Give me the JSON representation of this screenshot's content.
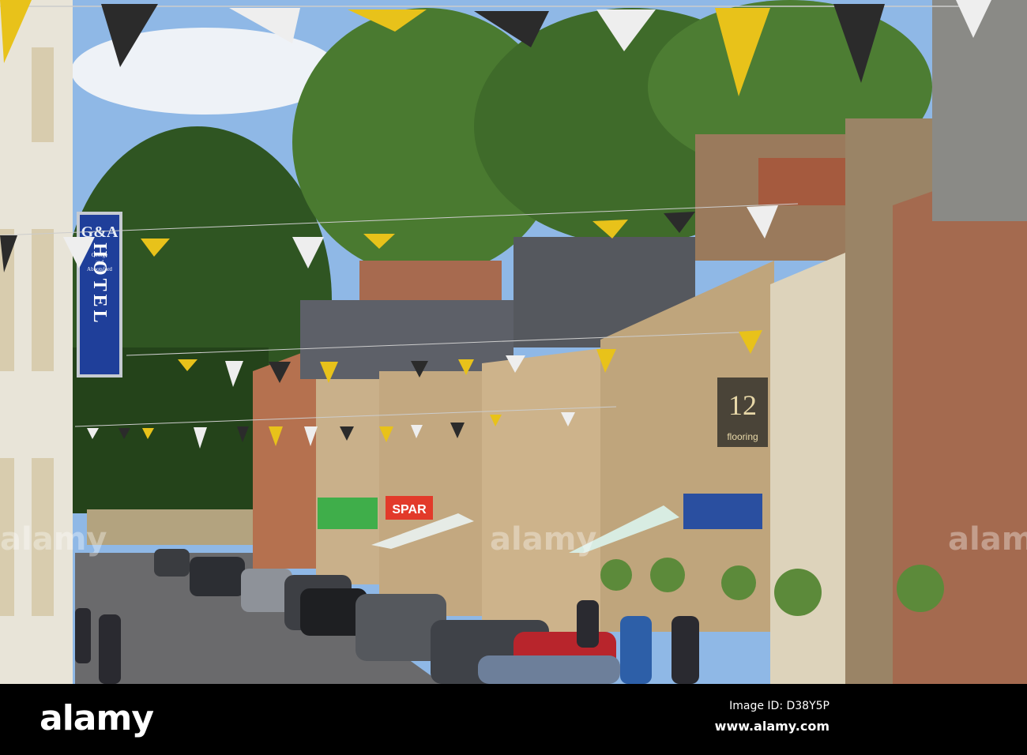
{
  "photo": {
    "hotel_sign": {
      "logo": "G&A",
      "line1": "George",
      "line2": "and",
      "line3": "Abbotsford",
      "word": "HOTEL"
    },
    "shop_sign": {
      "number": "12",
      "word": "flooring"
    },
    "spar_sign": "SPAR",
    "colors": {
      "sky": "#8fb8e6",
      "foliage": "#3f6b2a",
      "sandstone": "#c9b08a",
      "road": "#6a6a6c",
      "bunting_yellow": "#e8c21a",
      "bunting_black": "#2b2b2b",
      "hotel_blue": "#1f3f9a"
    }
  },
  "footer": {
    "logo": "alamy",
    "image_id": "Image ID: D38Y5P",
    "url": "www.alamy.com"
  },
  "watermark": "alamy"
}
